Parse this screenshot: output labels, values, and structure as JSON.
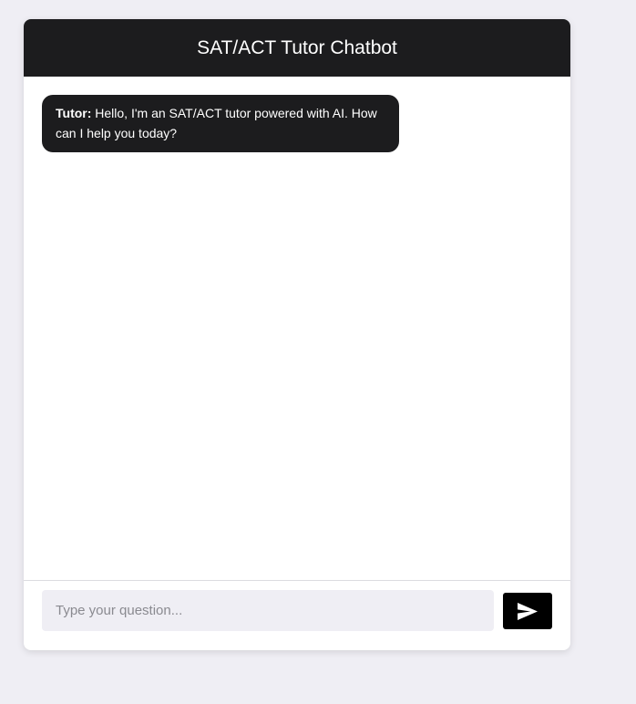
{
  "header": {
    "title": "SAT/ACT Tutor Chatbot"
  },
  "messages": [
    {
      "sender": "Tutor:",
      "text": " Hello, I'm an SAT/ACT tutor powered with AI. How can I help you today?"
    }
  ],
  "input": {
    "placeholder": "Type your question...",
    "value": ""
  },
  "send_button": {
    "icon": "send-icon"
  },
  "colors": {
    "page_background": "#efeef4",
    "header_background": "#1c1c1e",
    "bubble_background": "#1c1c1e",
    "send_button_background": "#000000"
  }
}
